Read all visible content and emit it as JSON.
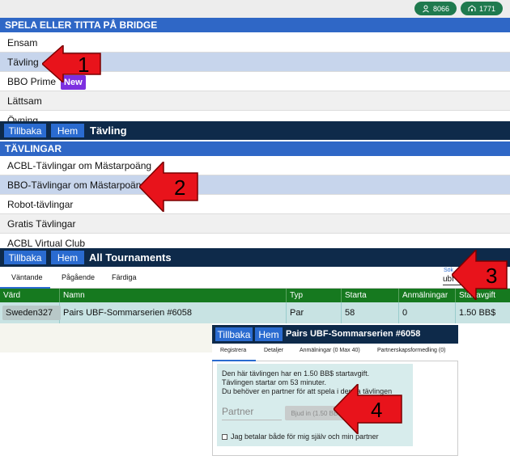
{
  "panel1": {
    "counters": [
      {
        "icon": "person-icon",
        "value": "8066"
      },
      {
        "icon": "people-icon",
        "value": "1771"
      }
    ],
    "section_title": "SPELA ELLER TITTA PÅ BRIDGE",
    "items": [
      {
        "label": "Ensam"
      },
      {
        "label": "Tävling"
      },
      {
        "label": "BBO Prime",
        "badge": "New"
      },
      {
        "label": "Lättsam"
      },
      {
        "label": "Övning"
      }
    ]
  },
  "panel2": {
    "back_label": "Tillbaka",
    "home_label": "Hem",
    "title": "Tävling",
    "section_title": "TÄVLINGAR",
    "items": [
      {
        "label": "ACBL-Tävlingar om Mästarpoäng"
      },
      {
        "label": "BBO-Tävlingar om Mästarpoäng"
      },
      {
        "label": "Robot-tävlingar"
      },
      {
        "label": "Gratis Tävlingar"
      },
      {
        "label": "ACBL Virtual Club"
      }
    ]
  },
  "panel3": {
    "back_label": "Tillbaka",
    "home_label": "Hem",
    "title": "All Tournaments",
    "tabs": [
      "Väntande",
      "Pågående",
      "Färdiga"
    ],
    "search": {
      "label": "Sök",
      "value": "ubf"
    },
    "columns": [
      "Värd",
      "Namn",
      "Typ",
      "Starta",
      "Anmälningar",
      "Startavgift"
    ],
    "rows": [
      [
        "Sweden327",
        "Pairs UBF-Sommarserien #6058",
        "Par",
        "58",
        "0",
        "1.50 BB$"
      ]
    ]
  },
  "panel4": {
    "back_label": "Tillbaka",
    "home_label": "Hem",
    "title": "Pairs UBF-Sommarserien #6058",
    "tabs": [
      "Registrera",
      "Detaljer",
      "Anmälningar (0 Max 40)",
      "Partnerskapsformedling (0)"
    ],
    "info_lines": [
      "Den här tävlingen har en 1.50 BB$ startavgift.",
      "Tävlingen startar om 53 minuter.",
      "Du behöver en partner för att spela i denna tävlingen"
    ],
    "partner_placeholder": "Partner",
    "invite_button": "Bjud in (1.50 BB$)",
    "pay_checkbox_label": "Jag betalar både för mig själv och min partner"
  },
  "annotations": [
    "1",
    "2",
    "3",
    "4"
  ],
  "colors": {
    "section_blue": "#2f67c6",
    "nav_dark": "#0e2a4a",
    "table_green": "#16791f",
    "counter_green": "#1f7a4e",
    "arrow_red": "#e8131b",
    "new_badge": "#7d2fe0"
  }
}
